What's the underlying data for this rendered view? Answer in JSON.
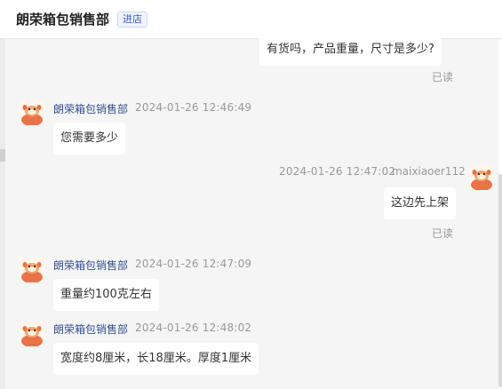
{
  "header": {
    "shop_name": "朗荣箱包销售部",
    "enter_label": "进店"
  },
  "messages": [
    {
      "side": "right",
      "text": "有货吗，产品重量，尺寸是多少?",
      "status": "已读"
    },
    {
      "side": "left",
      "sender": "朗荣箱包销售部",
      "time": "2024-01-26 12:46:49",
      "text": "您需要多少"
    },
    {
      "side": "right",
      "sender": "maixiaoer112",
      "time": "2024-01-26 12:47:02",
      "text": "这边先上架",
      "status": "已读"
    },
    {
      "side": "left",
      "sender": "朗荣箱包销售部",
      "time": "2024-01-26 12:47:09",
      "text": "重量约100克左右"
    },
    {
      "side": "left",
      "sender": "朗荣箱包销售部",
      "time": "2024-01-26 12:48:02",
      "text": "宽度约8厘米，长18厘米。厚度1厘米"
    }
  ],
  "colors": {
    "background": "#f5f5f5",
    "bubble": "#ffffff",
    "sender_name": "#35508f",
    "meta_text": "#999999",
    "avatar_accent": "#e8734a"
  }
}
